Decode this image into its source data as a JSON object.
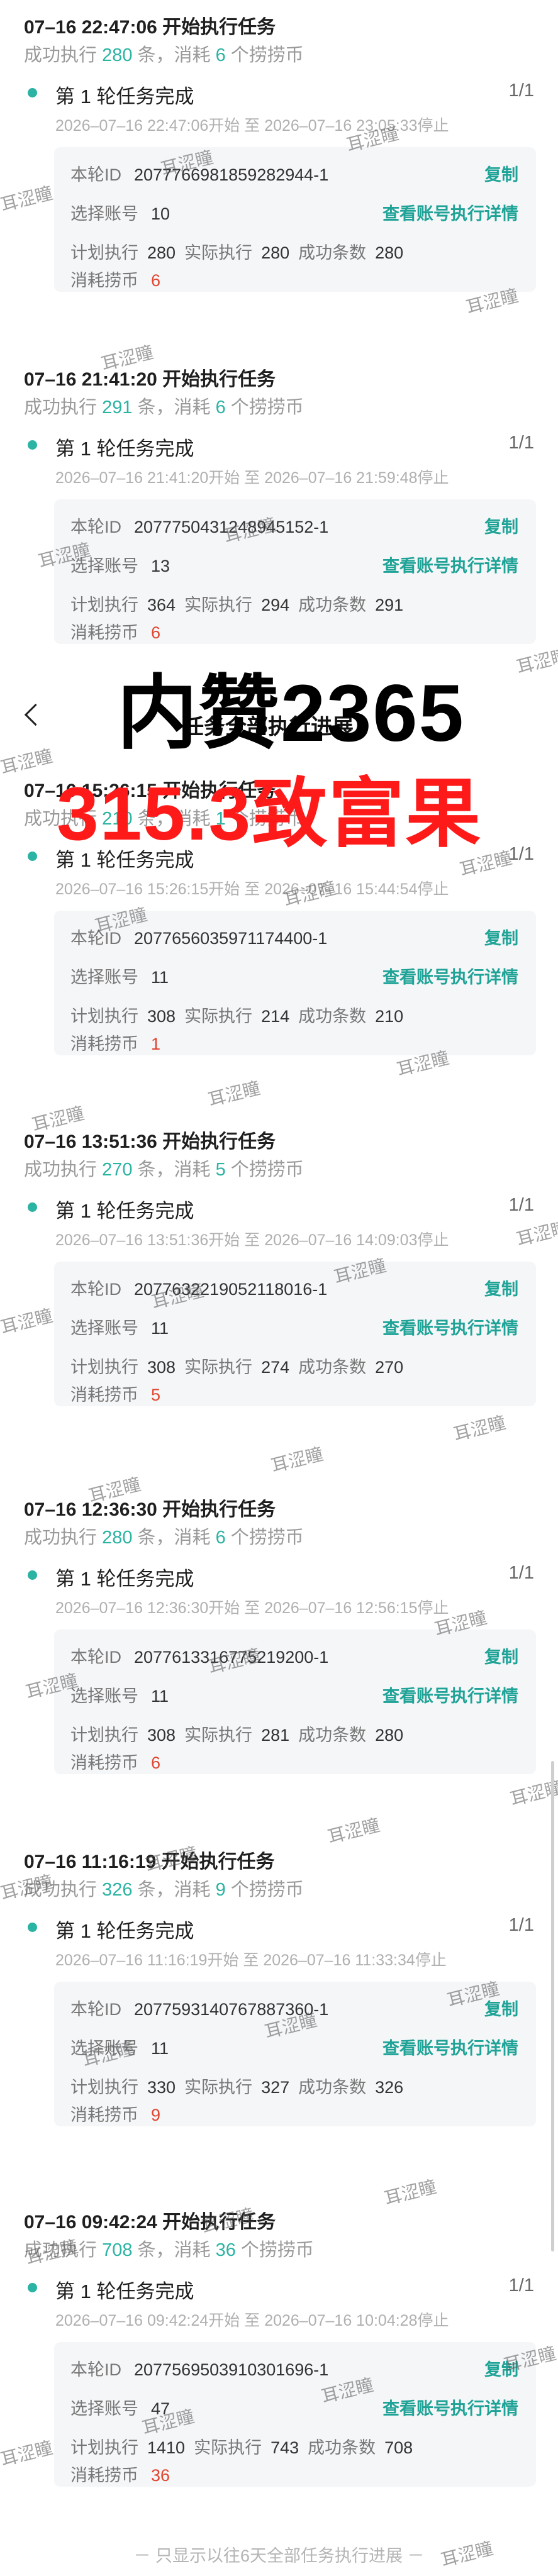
{
  "copy_label": "复制",
  "detail_label": "查看账号执行详情",
  "labels": {
    "round_id": "本轮ID",
    "accounts": "选择账号",
    "planned": "计划执行",
    "actual": "实际执行",
    "success": "成功条数",
    "cost": "消耗捞币"
  },
  "overlay": {
    "title": "任务全部执行进展",
    "big_text": "内赞2365",
    "red_text": "315.3致富果"
  },
  "watermark_text": "耳涩瞳",
  "footer": "－ 只显示以往6天全部任务执行进展 －",
  "tasks": [
    {
      "header": "07–16 22:47:06 开始执行任务",
      "s_pre": "成功执行 ",
      "success_num": "280",
      "s_mid": " 条，消耗 ",
      "cost_num": "6",
      "s_post": " 个捞捞币",
      "round_title": "第 1 轮任务完成",
      "round_count": "1/1",
      "round_time": "2026–07–16 22:47:06开始 至 2026–07–16 23:05:33停止",
      "round_id": "2077766981859282944-1",
      "accounts": "10",
      "planned": "280",
      "actual": "280",
      "success": "280",
      "cost": "6"
    },
    {
      "header": "07–16 21:41:20 开始执行任务",
      "s_pre": "成功执行 ",
      "success_num": "291",
      "s_mid": " 条，消耗 ",
      "cost_num": "6",
      "s_post": " 个捞捞币",
      "round_title": "第 1 轮任务完成",
      "round_count": "1/1",
      "round_time": "2026–07–16 21:41:20开始 至 2026–07–16 21:59:48停止",
      "round_id": "2077750431248945152-1",
      "accounts": "13",
      "planned": "364",
      "actual": "294",
      "success": "291",
      "cost": "6"
    },
    {
      "header": "07–16 15:26:15 开始执行任务",
      "s_pre": "成功执行 ",
      "success_num": "210",
      "s_mid": " 条，消耗 ",
      "cost_num": "1",
      "s_post": " 个捞捞币",
      "round_title": "第 1 轮任务完成",
      "round_count": "1/1",
      "round_time": "2026–07–16 15:26:15开始 至 2026–07–16 15:44:54停止",
      "round_id": "2077656035971174400-1",
      "accounts": "11",
      "planned": "308",
      "actual": "214",
      "success": "210",
      "cost": "1"
    },
    {
      "header": "07–16 13:51:36 开始执行任务",
      "s_pre": "成功执行 ",
      "success_num": "270",
      "s_mid": " 条，消耗 ",
      "cost_num": "5",
      "s_post": " 个捞捞币",
      "round_title": "第 1 轮任务完成",
      "round_count": "1/1",
      "round_time": "2026–07–16 13:51:36开始 至 2026–07–16 14:09:03停止",
      "round_id": "2077632219052118016-1",
      "accounts": "11",
      "planned": "308",
      "actual": "274",
      "success": "270",
      "cost": "5"
    },
    {
      "header": "07–16 12:36:30 开始执行任务",
      "s_pre": "成功执行 ",
      "success_num": "280",
      "s_mid": " 条，消耗 ",
      "cost_num": "6",
      "s_post": " 个捞捞币",
      "round_title": "第 1 轮任务完成",
      "round_count": "1/1",
      "round_time": "2026–07–16 12:36:30开始 至 2026–07–16 12:56:15停止",
      "round_id": "2077613316775219200-1",
      "accounts": "11",
      "planned": "308",
      "actual": "281",
      "success": "280",
      "cost": "6"
    },
    {
      "header": "07–16 11:16:19 开始执行任务",
      "s_pre": "成功执行 ",
      "success_num": "326",
      "s_mid": " 条，消耗 ",
      "cost_num": "9",
      "s_post": " 个捞捞币",
      "round_title": "第 1 轮任务完成",
      "round_count": "1/1",
      "round_time": "2026–07–16 11:16:19开始 至 2026–07–16 11:33:34停止",
      "round_id": "2077593140767887360-1",
      "accounts": "11",
      "planned": "330",
      "actual": "327",
      "success": "326",
      "cost": "9"
    },
    {
      "header": "07–16 09:42:24 开始执行任务",
      "s_pre": "成功执行 ",
      "success_num": "708",
      "s_mid": " 条，消耗 ",
      "cost_num": "36",
      "s_post": " 个捞捞币",
      "round_title": "第 1 轮任务完成",
      "round_count": "1/1",
      "round_time": "2026–07–16 09:42:24开始 至 2026–07–16 10:04:28停止",
      "round_id": "2077569503910301696-1",
      "accounts": "47",
      "planned": "1410",
      "actual": "743",
      "success": "708",
      "cost": "36"
    }
  ]
}
